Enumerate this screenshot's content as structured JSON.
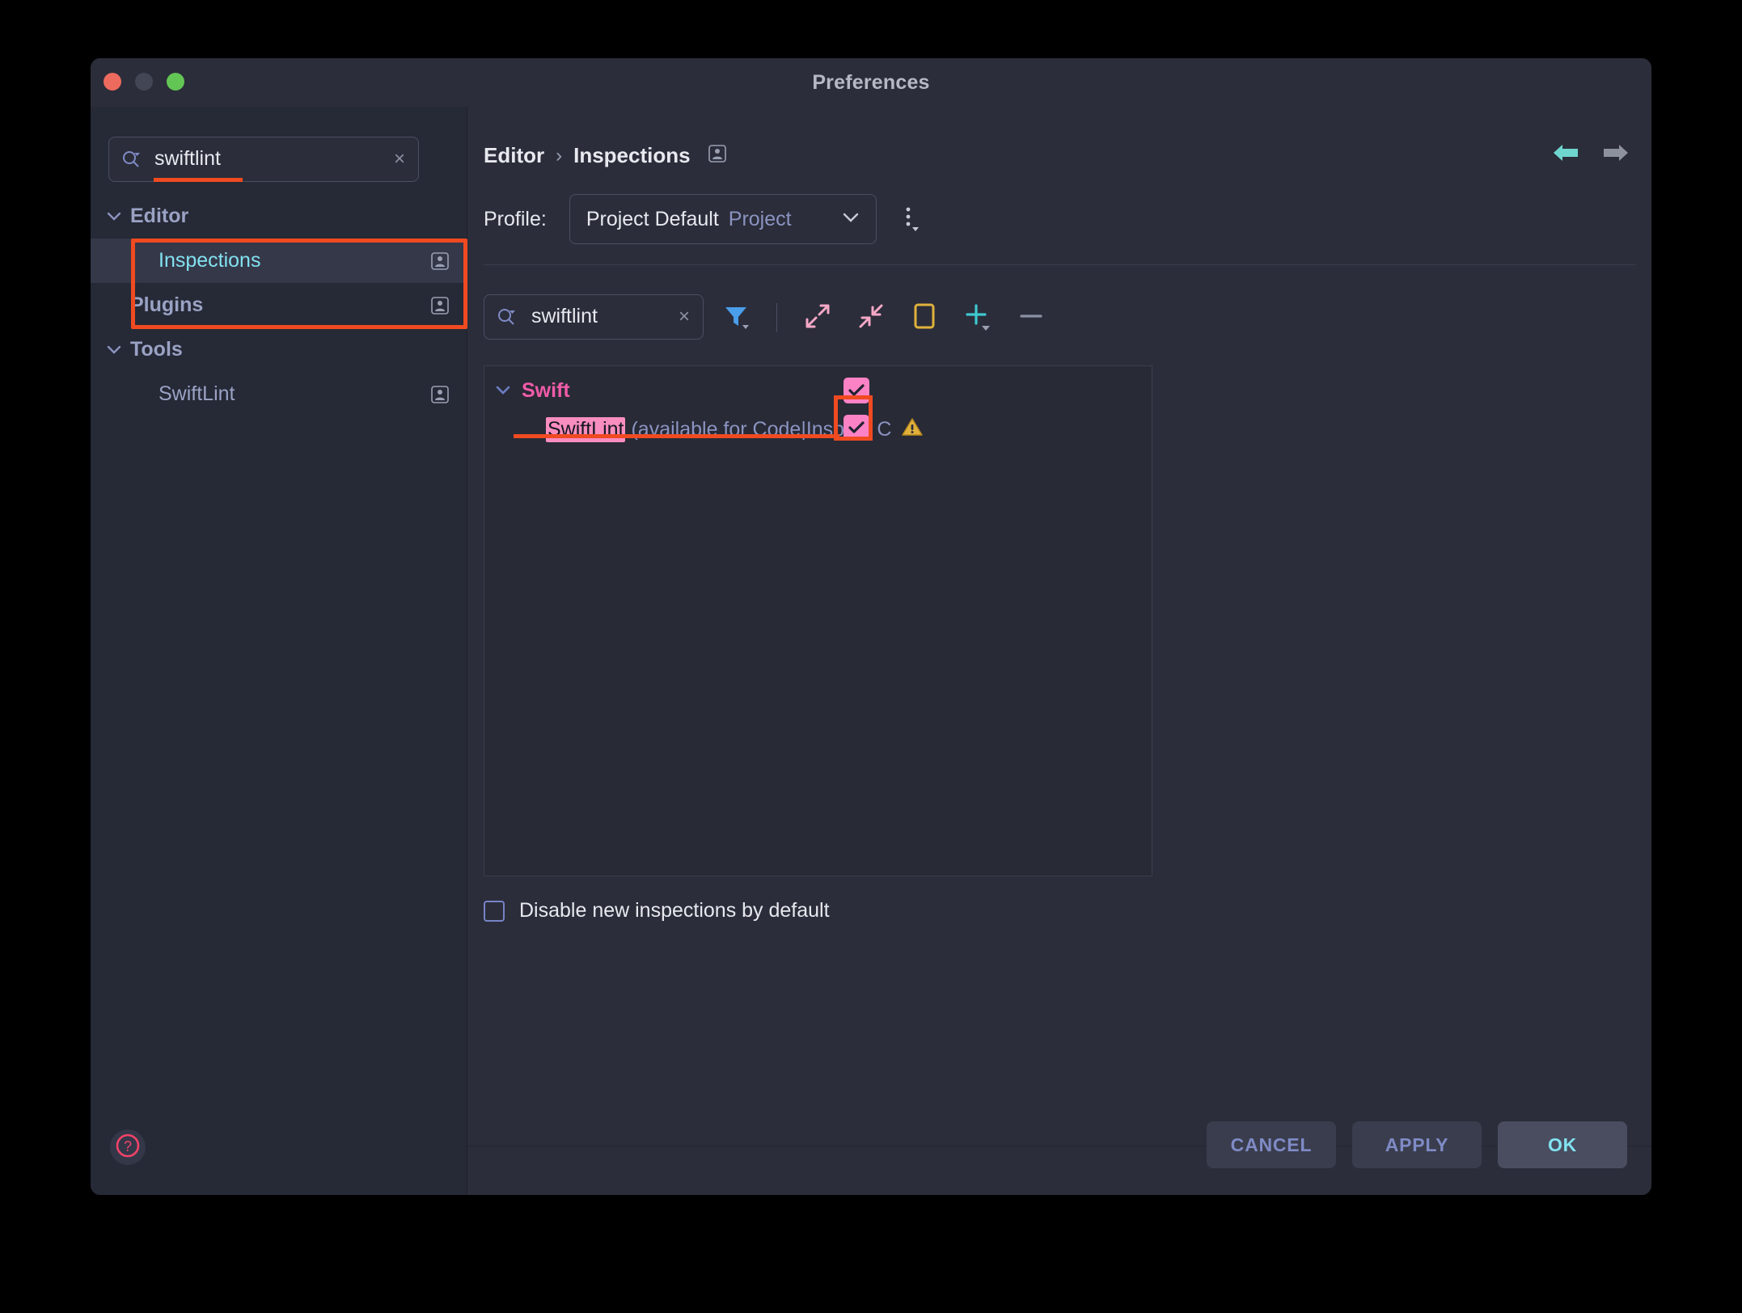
{
  "window": {
    "title": "Preferences",
    "traffic_lights": [
      "close-red",
      "minimize-gray",
      "zoom-green"
    ]
  },
  "sidebar": {
    "search": {
      "value": "swiftlint",
      "icon": "search-icon",
      "clear_icon": "×"
    },
    "tree": [
      {
        "label": "Editor",
        "level": 0,
        "expanded": true,
        "selected": false,
        "scope_icon": false
      },
      {
        "label": "Inspections",
        "level": 1,
        "expanded": null,
        "selected": true,
        "scope_icon": true
      },
      {
        "label": "Plugins",
        "level": 0,
        "expanded": null,
        "selected": false,
        "scope_icon": true
      },
      {
        "label": "Tools",
        "level": 0,
        "expanded": true,
        "selected": false,
        "scope_icon": false
      },
      {
        "label": "SwiftLint",
        "level": 1,
        "expanded": null,
        "selected": false,
        "scope_icon": true
      }
    ],
    "help_icon": "question-circle-icon"
  },
  "content": {
    "breadcrumb": {
      "root": "Editor",
      "separator": "›",
      "leaf": "Inspections",
      "scope_icon": "project-scope-icon"
    },
    "nav": {
      "back_icon": "arrow-left-icon",
      "forward_icon": "arrow-right-icon"
    },
    "profile": {
      "label": "Profile:",
      "name": "Project Default",
      "scope": "Project",
      "dropdown_icon": "chevron-down-icon",
      "menu_icon": "kebab-menu-icon"
    },
    "inspection_search": {
      "value": "swiftlint",
      "icon": "search-icon",
      "clear_icon": "×"
    },
    "toolbar": [
      {
        "name": "filter-icon",
        "color": "#4a9eea"
      },
      {
        "name": "expand-all-icon",
        "color": "#f5a8c6"
      },
      {
        "name": "collapse-all-icon",
        "color": "#f5a8c6"
      },
      {
        "name": "group-by-icon",
        "color": "#e0b23c"
      },
      {
        "name": "add-icon",
        "color": "#3ec8d0"
      },
      {
        "name": "remove-icon",
        "color": "#8b91a3"
      }
    ],
    "inspections": [
      {
        "label": "Swift",
        "level": 0,
        "expanded": true,
        "checked": true,
        "match": null,
        "description": null,
        "warning": false
      },
      {
        "label": "SwiftLint",
        "level": 1,
        "expanded": null,
        "checked": true,
        "match": "SwiftLint",
        "description": "(available for Code|Inspect C",
        "warning": true,
        "warning_icon": "warning-triangle-icon"
      }
    ],
    "disable_new": {
      "label": "Disable new inspections by default",
      "checked": false
    },
    "buttons": [
      {
        "label": "CANCEL",
        "primary": false
      },
      {
        "label": "APPLY",
        "primary": false
      },
      {
        "label": "OK",
        "primary": true
      }
    ]
  },
  "annotations": {
    "accent_color": "#f04a21",
    "items": [
      "sidebar-editor-inspections-box",
      "sidebar-search-underline",
      "swiftlint-row-underline",
      "swiftlint-checkbox-box"
    ]
  }
}
